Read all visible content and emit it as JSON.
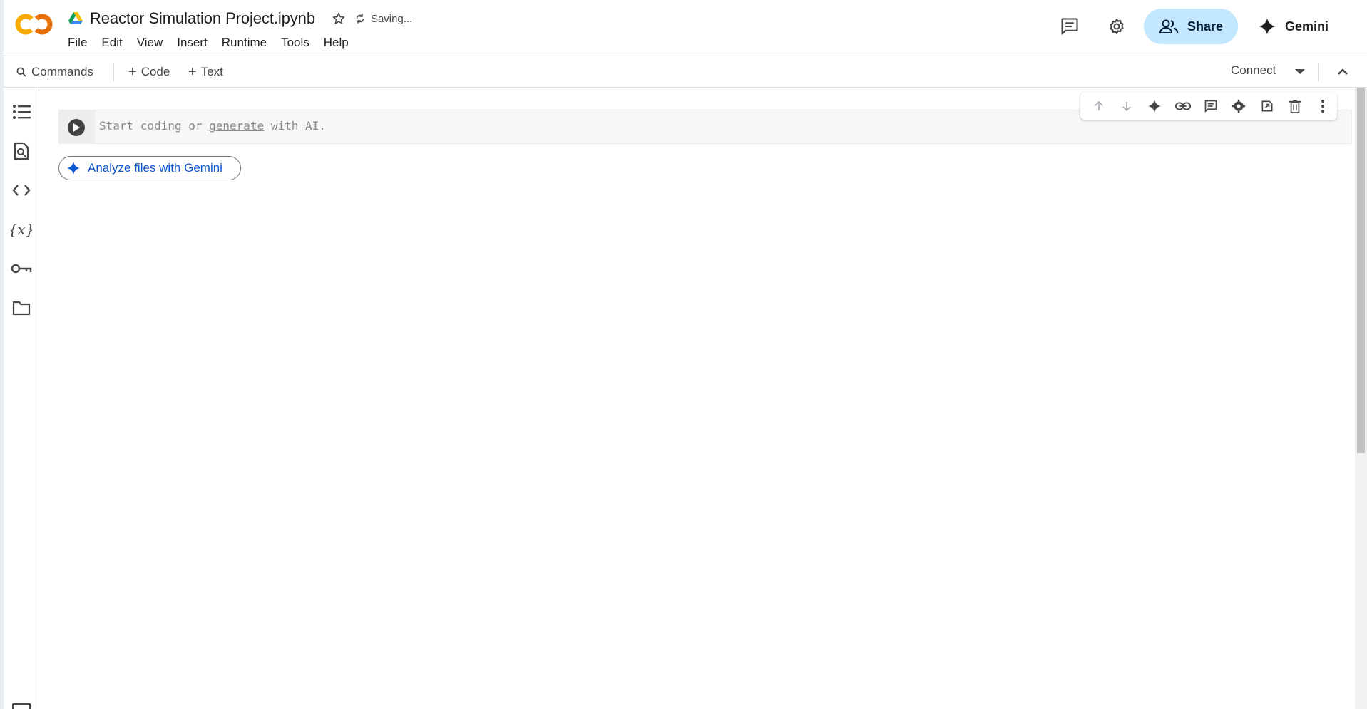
{
  "header": {
    "doc_title": "Reactor Simulation Project.ipynb",
    "status": "Saving...",
    "menu": [
      "File",
      "Edit",
      "View",
      "Insert",
      "Runtime",
      "Tools",
      "Help"
    ],
    "share_label": "Share",
    "gemini_label": "Gemini"
  },
  "toolbar": {
    "commands_label": "Commands",
    "code_label": "Code",
    "text_label": "Text",
    "connect_label": "Connect"
  },
  "sidebar": {
    "items": [
      "table-of-contents-icon",
      "find-replace-icon",
      "code-snippets-icon",
      "variables-icon",
      "secrets-key-icon",
      "files-folder-icon",
      "terminal-icon"
    ]
  },
  "cell": {
    "placeholder_prefix": "Start coding or",
    "placeholder_link": "generate",
    "placeholder_suffix": "with AI."
  },
  "analyze_chip_label": "Analyze files with Gemini",
  "colors": {
    "share_bg": "#c2e7ff",
    "link_blue": "#0b57d0",
    "colab_orange": "#f9ab00",
    "colab_orange_dark": "#e8710a"
  }
}
